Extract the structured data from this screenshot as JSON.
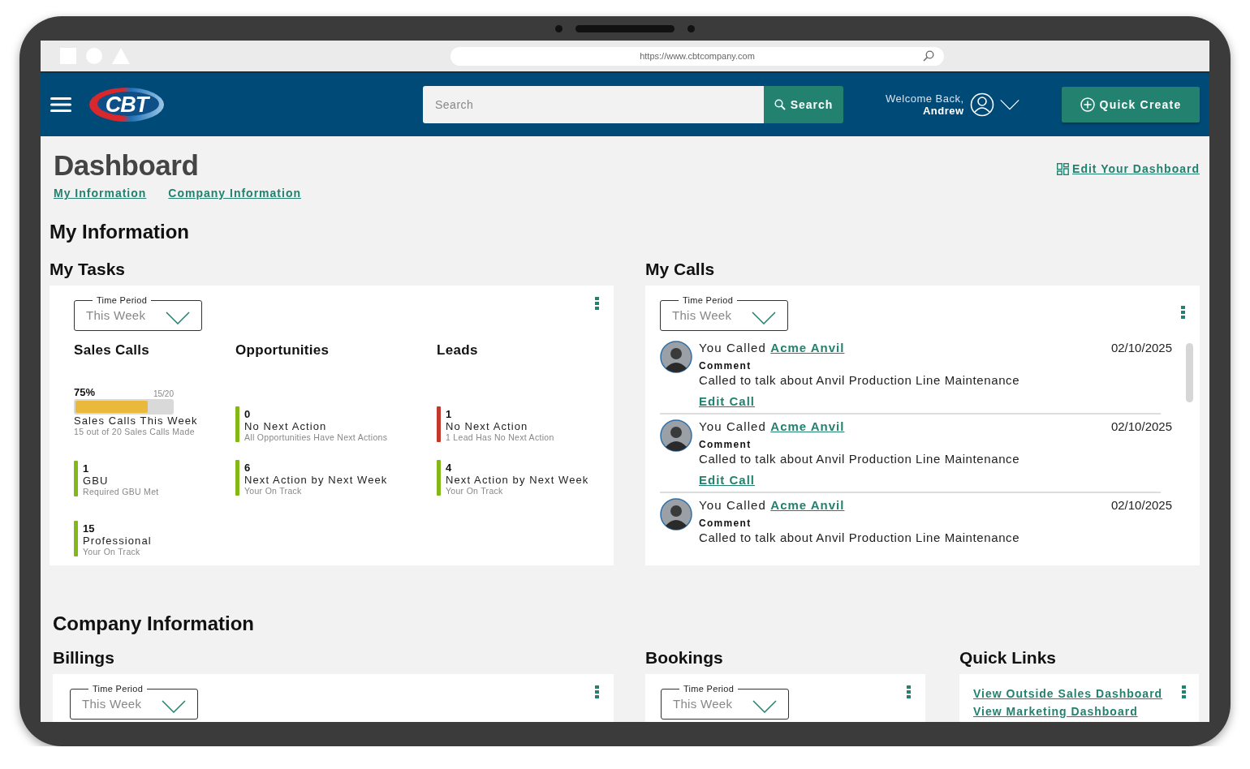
{
  "browser": {
    "url": "https://www.cbtcompany.com"
  },
  "header": {
    "logo": "CBT",
    "search": {
      "placeholder": "Search",
      "button": "Search"
    },
    "welcome": "Welcome Back,",
    "user": "Andrew",
    "quick_create": "Quick Create"
  },
  "page": {
    "title": "Dashboard",
    "anchors": [
      "My Information",
      "Company Information"
    ],
    "edit_link": "Edit Your Dashboard"
  },
  "my_information": {
    "title": "My Information",
    "tasks": {
      "title": "My Tasks",
      "time_period": {
        "label": "Time Period",
        "value": "This Week"
      },
      "columns": [
        {
          "title": "Sales Calls",
          "progress": {
            "percent": "75%",
            "ratio": "15/20",
            "level": 0.75,
            "label": "Sales Calls This Week",
            "detail": "15 out of 20 Sales Calls Made"
          },
          "metrics": [
            {
              "value": "1",
              "label": "GBU",
              "detail": "Required GBU Met",
              "color": "#84b818"
            },
            {
              "value": "15",
              "label": "Professional",
              "detail": "Your On Track",
              "color": "#84b818"
            }
          ]
        },
        {
          "title": "Opportunities",
          "metrics": [
            {
              "value": "0",
              "label": "No Next Action",
              "detail": "All Opportunities Have Next Actions",
              "color": "#84b818"
            },
            {
              "value": "6",
              "label": "Next Action by Next Week",
              "detail": "Your On Track",
              "color": "#84b818"
            }
          ]
        },
        {
          "title": "Leads",
          "metrics": [
            {
              "value": "1",
              "label": "No Next Action",
              "detail": "1 Lead Has No Next Action",
              "color": "#c0392b"
            },
            {
              "value": "4",
              "label": "Next Action by Next Week",
              "detail": "Your On Track",
              "color": "#84b818"
            }
          ]
        }
      ]
    },
    "calls": {
      "title": "My Calls",
      "time_period": {
        "label": "Time Period",
        "value": "This Week"
      },
      "items": [
        {
          "prefix": "You Called",
          "company": "Acme Anvil",
          "date": "02/10/2025",
          "comment_label": "Comment",
          "comment": "Called to talk about Anvil Production Line Maintenance",
          "edit": "Edit Call"
        },
        {
          "prefix": "You Called",
          "company": "Acme Anvil",
          "date": "02/10/2025",
          "comment_label": "Comment",
          "comment": "Called to talk about Anvil Production Line Maintenance",
          "edit": "Edit Call"
        },
        {
          "prefix": "You Called",
          "company": "Acme Anvil",
          "date": "02/10/2025",
          "comment_label": "Comment",
          "comment": "Called to talk about Anvil Production Line Maintenance"
        }
      ]
    }
  },
  "company_information": {
    "title": "Company Information",
    "billings": {
      "title": "Billings",
      "time_period": {
        "label": "Time Period",
        "value": "This Week"
      }
    },
    "bookings": {
      "title": "Bookings",
      "time_period": {
        "label": "Time Period",
        "value": "This Week"
      }
    },
    "quick_links": {
      "title": "Quick Links",
      "links": [
        "View Outside Sales Dashboard",
        "View Marketing Dashboard"
      ]
    }
  }
}
